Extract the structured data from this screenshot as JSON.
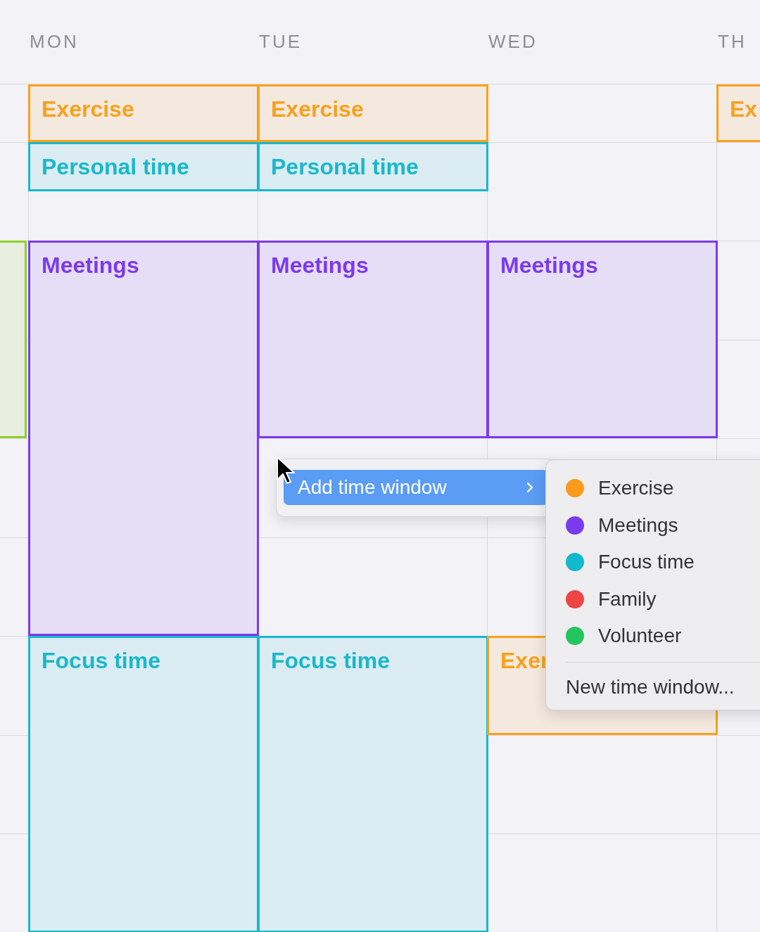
{
  "calendar": {
    "days": [
      {
        "events": [
          {
            "color": "#8fd12a"
          }
        ]
      },
      {
        "label": "MON",
        "events": [
          {
            "title": "Exercise",
            "color": "#f9a11b"
          },
          {
            "title": "Personal time",
            "color": "#19b8cb"
          },
          {
            "title": "Meetings",
            "color": "#7c3aed"
          },
          {
            "title": "Focus time",
            "color": "#19b8cb"
          }
        ]
      },
      {
        "label": "TUE",
        "events": [
          {
            "title": "Exercise",
            "color": "#f9a11b"
          },
          {
            "title": "Personal time",
            "color": "#19b8cb"
          },
          {
            "title": "Meetings",
            "color": "#7c3aed"
          },
          {
            "title": "Focus time",
            "color": "#19b8cb"
          }
        ]
      },
      {
        "label": "WED",
        "events": [
          {
            "title": "Meetings",
            "color": "#7c3aed"
          },
          {
            "title": "Exer",
            "color": "#f9a11b"
          }
        ]
      },
      {
        "label": "TH",
        "events": [
          {
            "title": "Ex",
            "color": "#f9a11b"
          }
        ]
      }
    ]
  },
  "context_menu": {
    "items": [
      {
        "label": "Add time window",
        "selected": true,
        "has_submenu": true
      }
    ]
  },
  "submenu": {
    "items": [
      {
        "label": "Exercise",
        "color": "#fd9a1b"
      },
      {
        "label": "Meetings",
        "color": "#7c3aed"
      },
      {
        "label": "Focus time",
        "color": "#12b8cc"
      },
      {
        "label": "Family",
        "color": "#ef4444"
      },
      {
        "label": "Volunteer",
        "color": "#22c55e"
      }
    ],
    "footer": "New time window..."
  }
}
